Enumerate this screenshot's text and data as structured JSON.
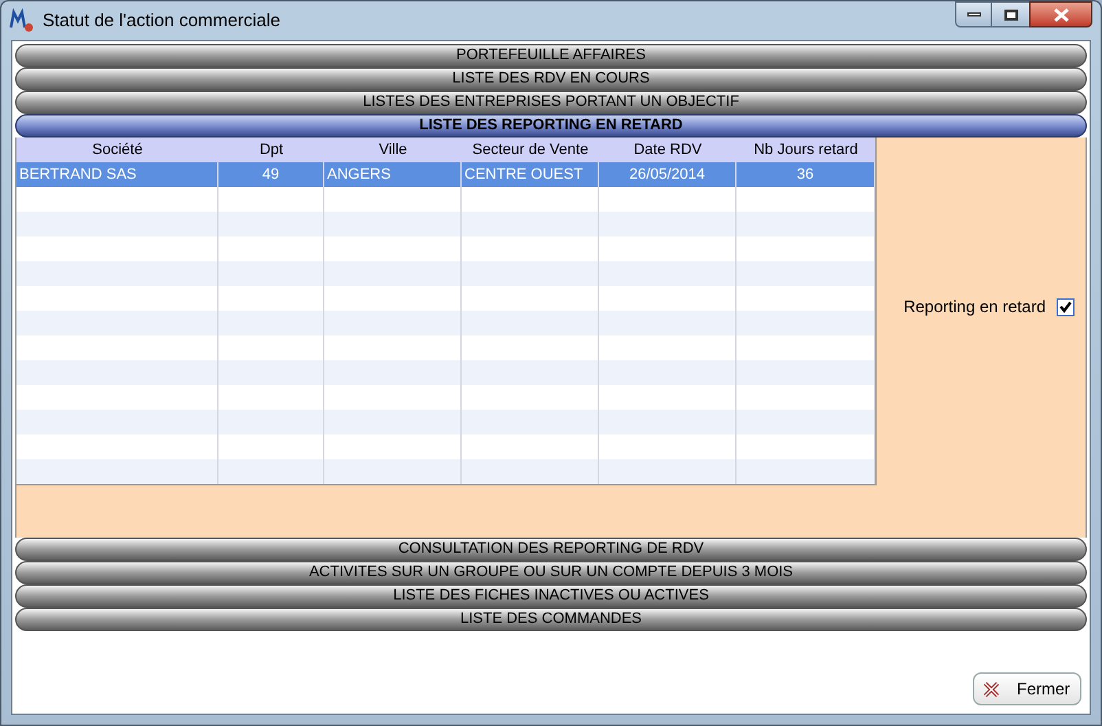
{
  "window": {
    "title": "Statut de l'action commerciale"
  },
  "sections": [
    {
      "label": "PORTEFEUILLE AFFAIRES",
      "selected": false
    },
    {
      "label": "LISTE DES RDV EN COURS",
      "selected": false
    },
    {
      "label": "LISTES DES ENTREPRISES PORTANT UN OBJECTIF",
      "selected": false
    },
    {
      "label": "LISTE DES REPORTING EN RETARD",
      "selected": true
    },
    {
      "label": "CONSULTATION DES REPORTING DE RDV",
      "selected": false
    },
    {
      "label": "ACTIVITES SUR UN GROUPE OU SUR UN COMPTE DEPUIS 3 MOIS",
      "selected": false
    },
    {
      "label": "LISTE DES FICHES INACTIVES OU ACTIVES",
      "selected": false
    },
    {
      "label": "LISTE DES COMMANDES",
      "selected": false
    }
  ],
  "table": {
    "columns": [
      "Société",
      "Dpt",
      "Ville",
      "Secteur de Vente",
      "Date RDV",
      "Nb Jours retard"
    ],
    "rows": [
      {
        "cells": [
          "BERTRAND SAS",
          "49",
          "ANGERS",
          "CENTRE OUEST",
          "26/05/2014",
          "36"
        ],
        "selected": true
      }
    ]
  },
  "filter": {
    "label": "Reporting en retard",
    "checked": true
  },
  "buttons": [
    {
      "label": "Fermer"
    }
  ]
}
